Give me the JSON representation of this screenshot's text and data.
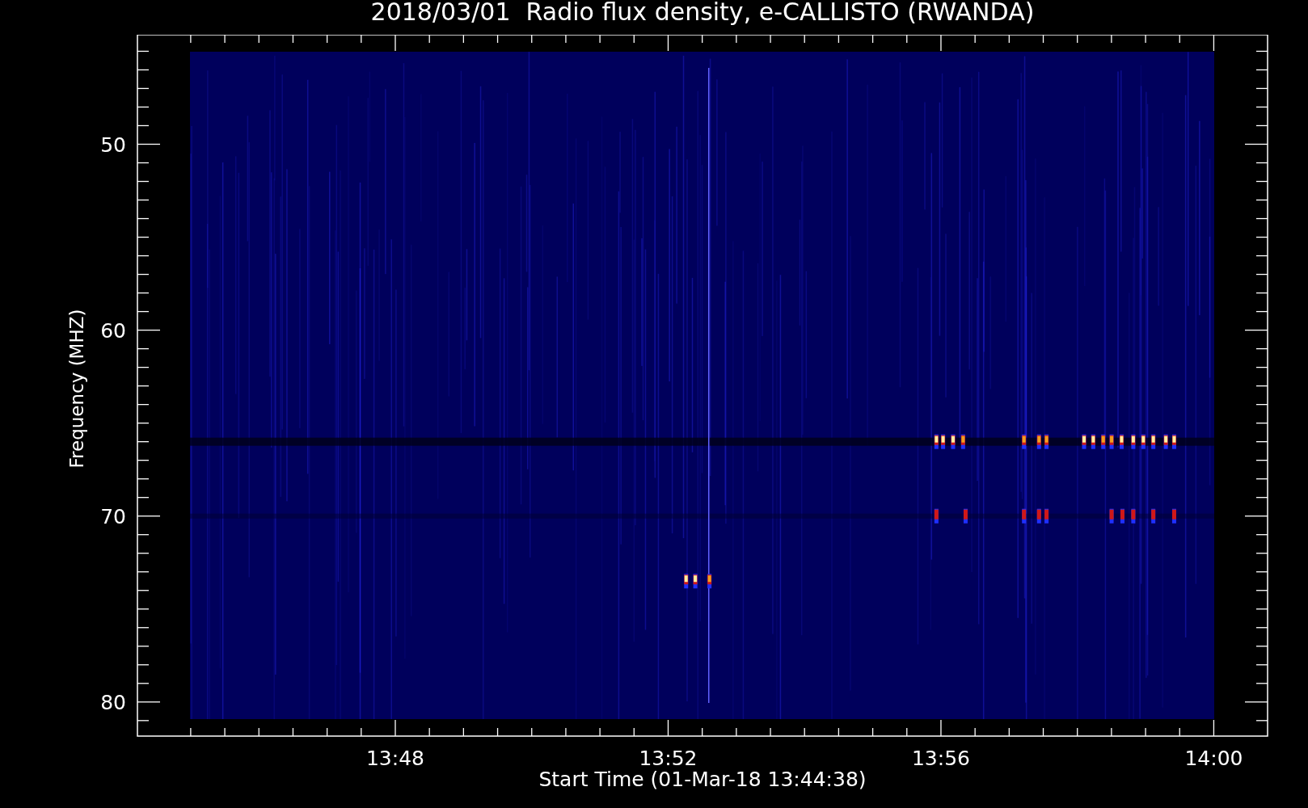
{
  "title": "2018/03/01  Radio flux density, e-CALLISTO (RWANDA)",
  "y_axis": {
    "label": "Frequency (MHZ)",
    "tick_labels": [
      "50",
      "60",
      "70",
      "80"
    ]
  },
  "x_axis": {
    "label": "Start Time (01-Mar-18 13:44:38)",
    "tick_labels": [
      "13:48",
      "13:52",
      "13:56",
      "14:00"
    ]
  }
}
